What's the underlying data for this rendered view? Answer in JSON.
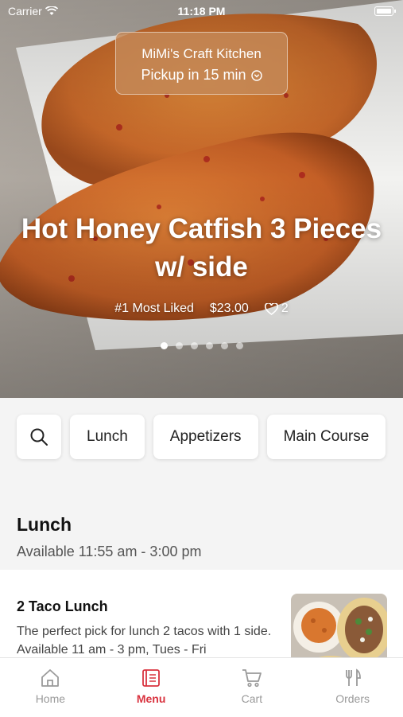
{
  "status": {
    "carrier": "Carrier",
    "time": "11:18 PM"
  },
  "store": {
    "name": "MiMi's Craft Kitchen",
    "pickup": "Pickup in 15 min"
  },
  "hero": {
    "title": "Hot Honey Catfish 3 Pieces w/ side",
    "badge": "#1 Most Liked",
    "price": "$23.00",
    "likes": "2",
    "slide_count": 6,
    "active_slide": 1
  },
  "categories": {
    "search_icon": "search-icon",
    "items": [
      "Lunch",
      "Appetizers",
      "Main Course"
    ]
  },
  "section": {
    "title": "Lunch",
    "hours": "Available 11:55 am - 3:00 pm"
  },
  "item": {
    "name": "2 Taco Lunch",
    "description": "The perfect pick for lunch 2 tacos with 1 side. Available 11 am - 3 pm, Tues - Fri"
  },
  "tabs": [
    {
      "label": "Home",
      "icon": "home-icon"
    },
    {
      "label": "Menu",
      "icon": "menu-icon",
      "active": true
    },
    {
      "label": "Cart",
      "icon": "cart-icon"
    },
    {
      "label": "Orders",
      "icon": "orders-icon"
    }
  ],
  "colors": {
    "accent": "#d9333f",
    "pill": "#c48958"
  }
}
